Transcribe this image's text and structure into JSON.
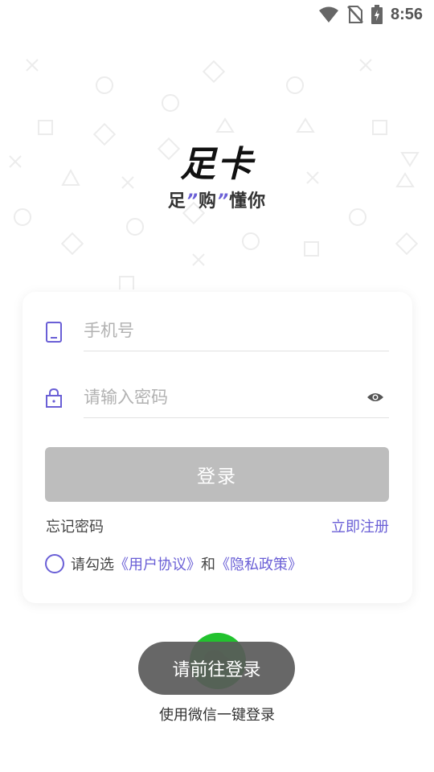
{
  "status_bar": {
    "time": "8:56",
    "icons": [
      "wifi-icon",
      "no-sim-icon",
      "battery-charging-icon"
    ]
  },
  "brand": {
    "logo_text": "足卡",
    "slogan": {
      "part1": "足",
      "quote_open": "”",
      "part2": "购",
      "quote_close": "”",
      "part3": "懂你"
    },
    "accent_color": "#6a5fd6"
  },
  "login_form": {
    "phone_placeholder": "手机号",
    "phone_value": "",
    "password_placeholder": "请输入密码",
    "password_value": "",
    "login_button_label": "登录",
    "forgot_password_label": "忘记密码",
    "register_label": "立即注册",
    "agreement": {
      "prefix": "请勾选",
      "user_agreement": "《用户协议》",
      "conjunction": "和",
      "privacy_policy": "《隐私政策》",
      "checked": false
    }
  },
  "toast": {
    "message": "请前往登录"
  },
  "wechat": {
    "label": "使用微信一键登录",
    "brand_color": "#22c22e"
  }
}
